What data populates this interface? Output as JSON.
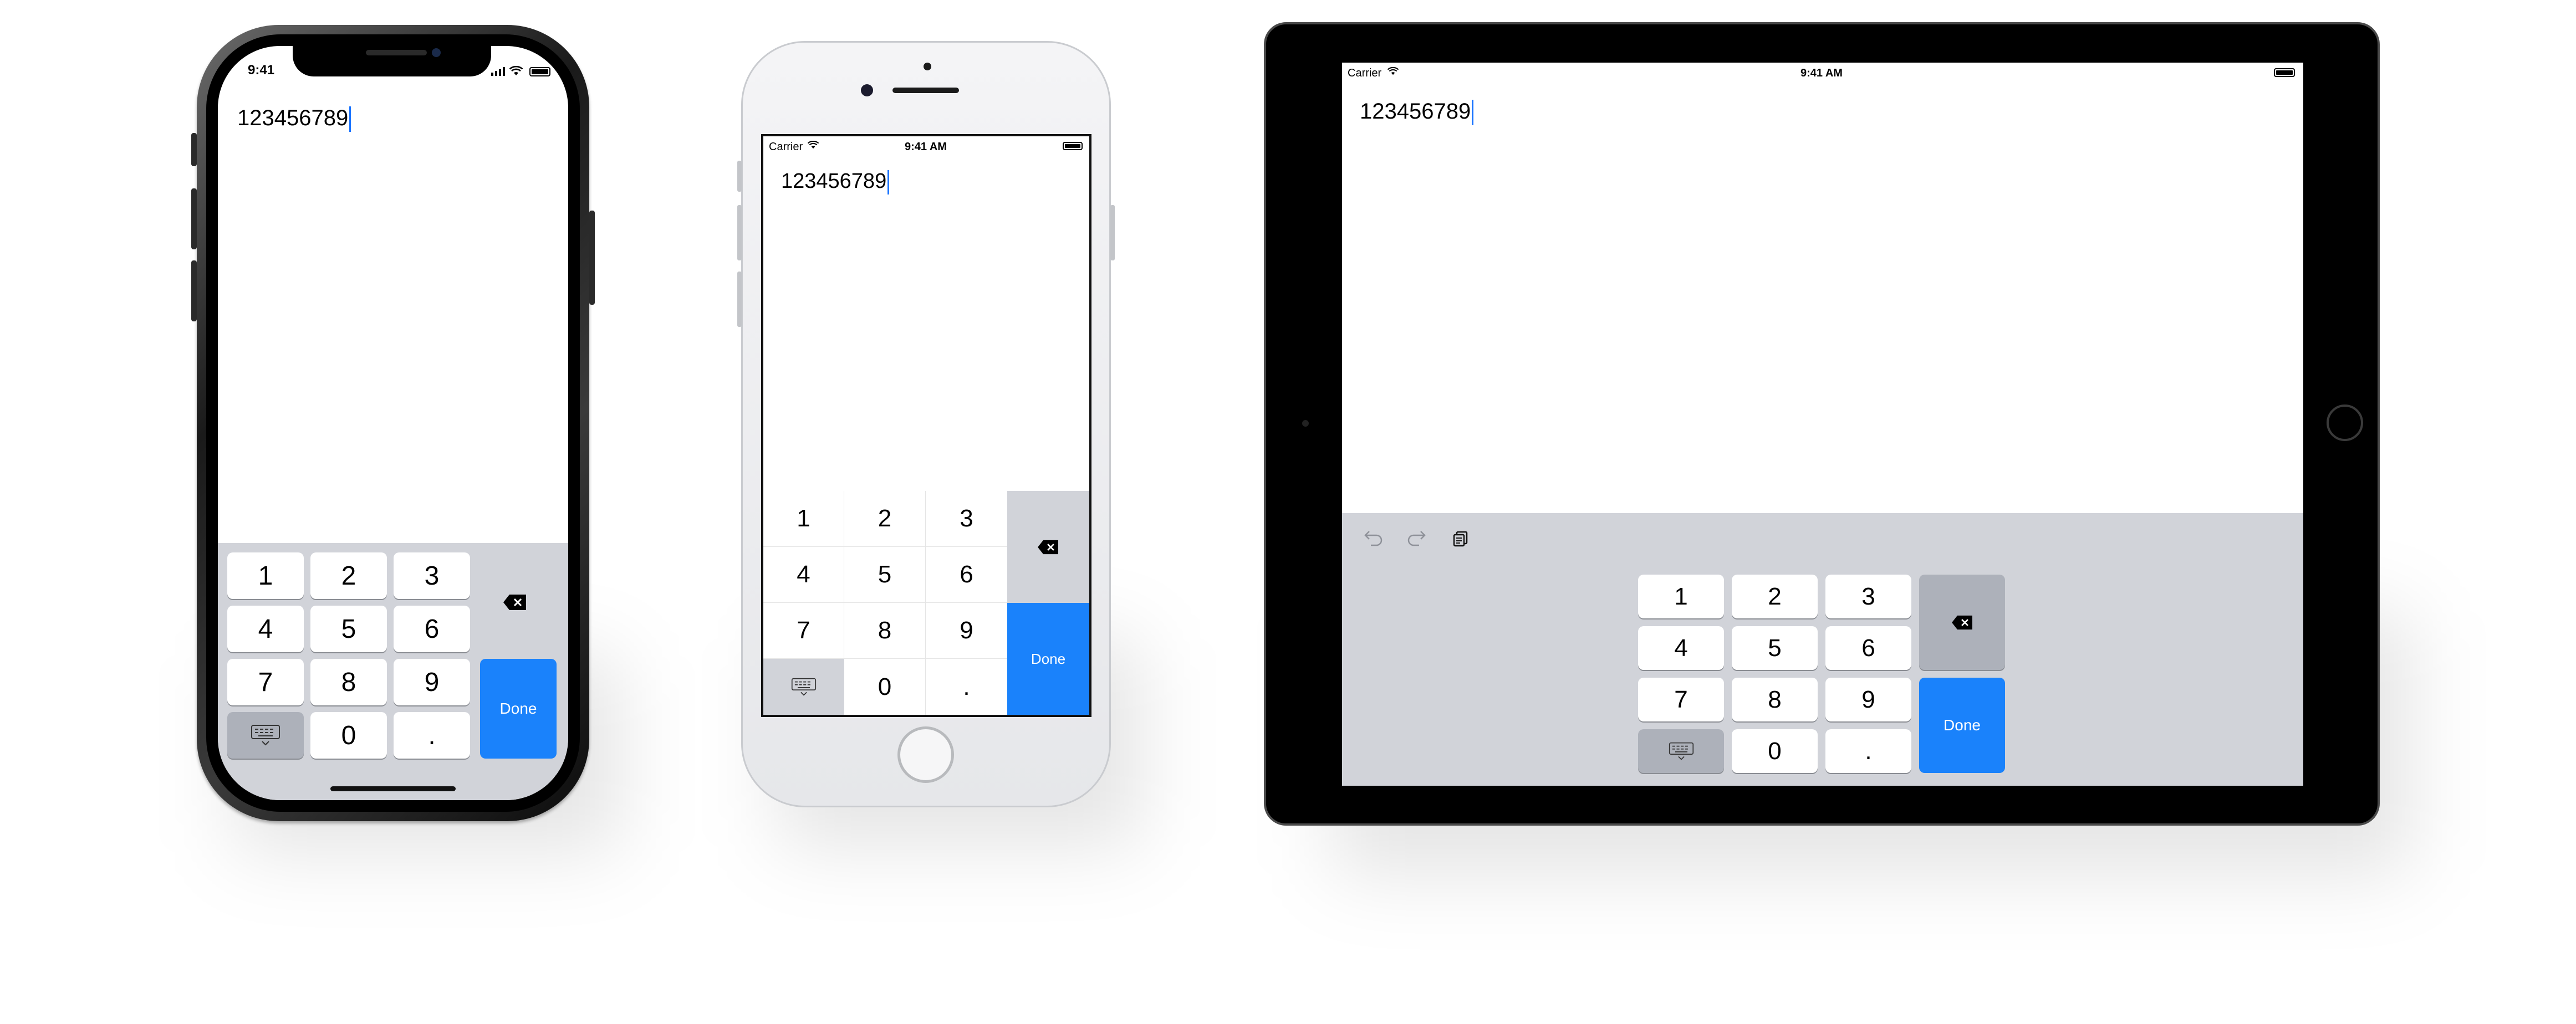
{
  "iphone_x": {
    "status": {
      "time": "9:41"
    },
    "field_text": "123456789",
    "keypad": {
      "keys": [
        "1",
        "2",
        "3",
        "4",
        "5",
        "6",
        "7",
        "8",
        "9",
        "0",
        "."
      ],
      "done_label": "Done"
    }
  },
  "iphone_8": {
    "status": {
      "carrier": "Carrier",
      "time": "9:41 AM"
    },
    "field_text": "123456789",
    "keypad": {
      "keys": [
        "1",
        "2",
        "3",
        "4",
        "5",
        "6",
        "7",
        "8",
        "9",
        "0",
        "."
      ],
      "done_label": "Done"
    }
  },
  "ipad": {
    "status": {
      "carrier": "Carrier",
      "time": "9:41 AM"
    },
    "field_text": "123456789",
    "toolbar": {
      "icons": [
        "undo-icon",
        "redo-icon",
        "paste-icon"
      ]
    },
    "keypad": {
      "keys": [
        "1",
        "2",
        "3",
        "4",
        "5",
        "6",
        "7",
        "8",
        "9",
        "0",
        "."
      ],
      "done_label": "Done"
    }
  },
  "colors": {
    "accent": "#1a82fb",
    "keyboard_bg": "#d1d3d9",
    "function_key": "#adb1ba"
  }
}
